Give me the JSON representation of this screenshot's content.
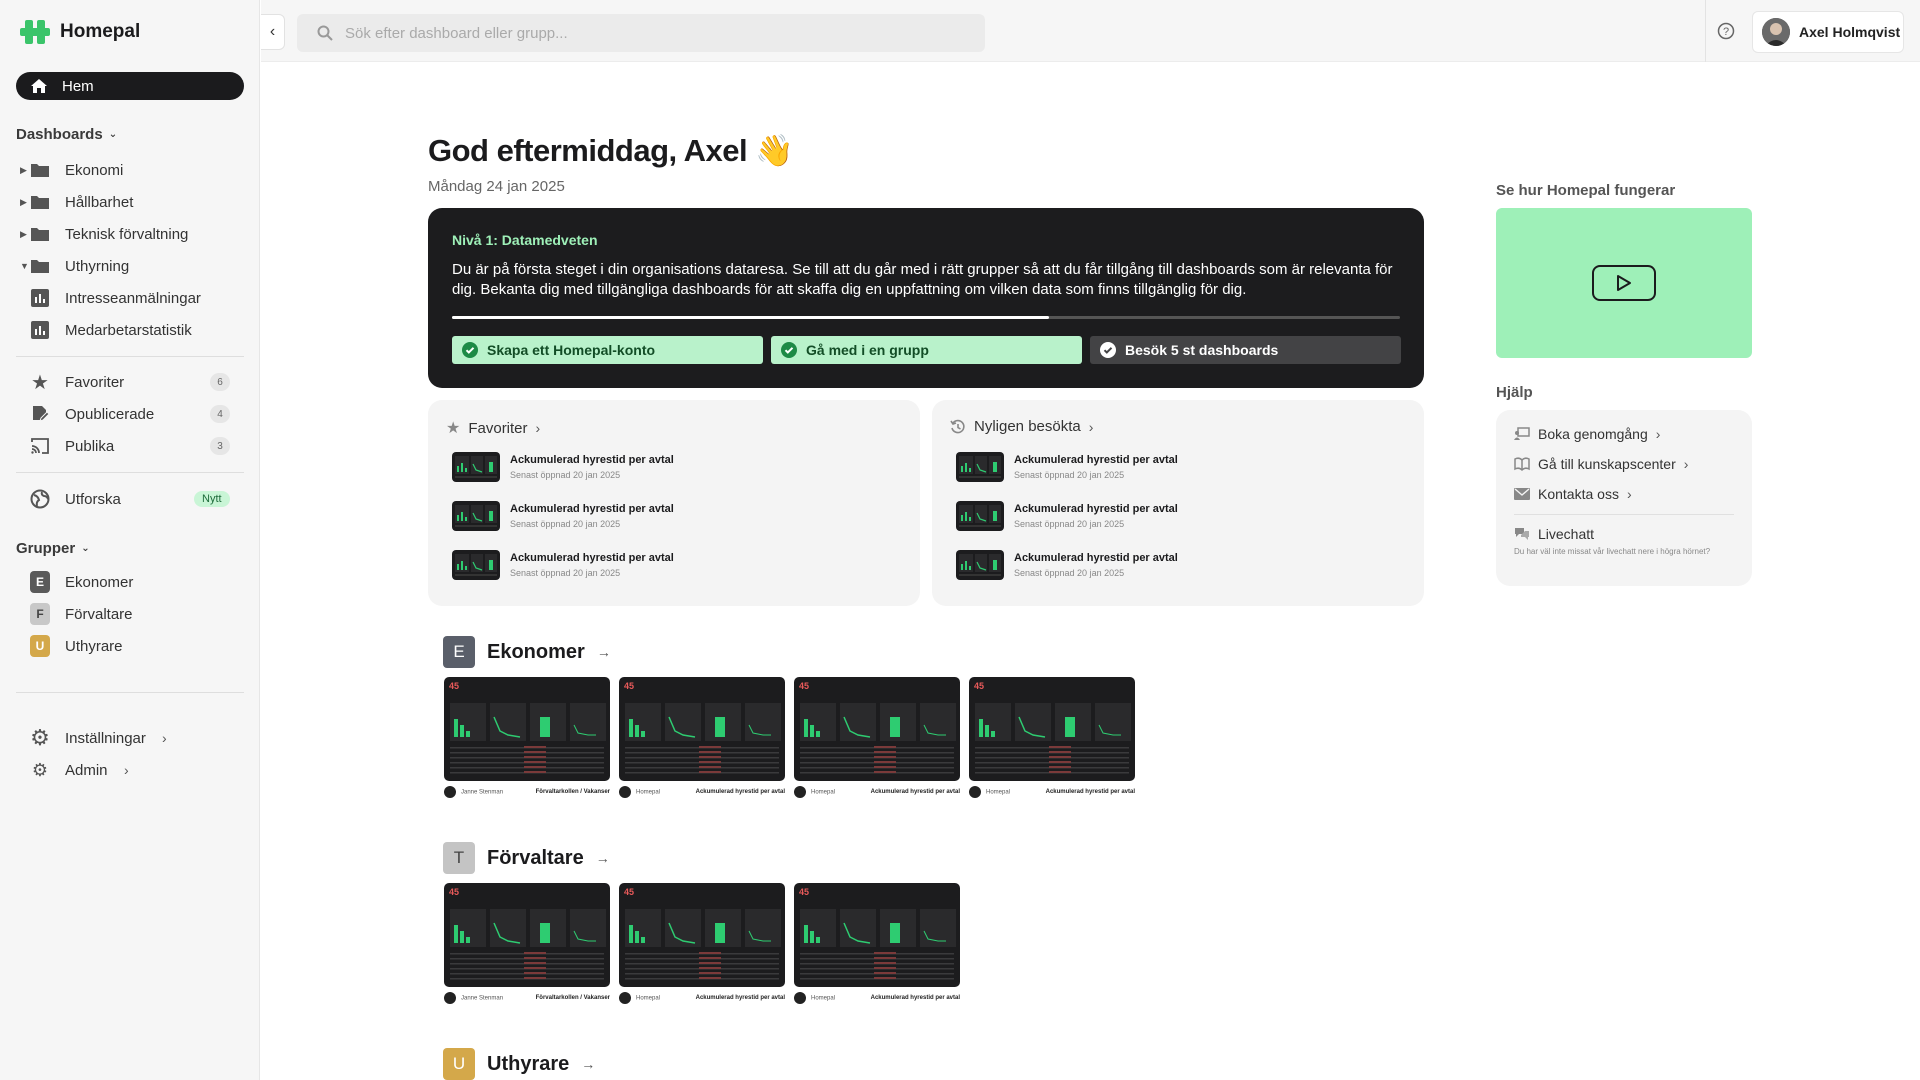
{
  "app": {
    "name": "Homepal"
  },
  "nav": {
    "home": "Hem",
    "dashboards_label": "Dashboards",
    "folders": [
      "Ekonomi",
      "Hållbarhet",
      "Teknisk förvaltning",
      "Uthyrning"
    ],
    "sub_dashboards": [
      "Intresseanmälningar",
      "Medarbetarstatistik"
    ],
    "favoriter": {
      "label": "Favoriter",
      "count": "6"
    },
    "opublicerade": {
      "label": "Opublicerade",
      "count": "4"
    },
    "publika": {
      "label": "Publika",
      "count": "3"
    },
    "utforska": {
      "label": "Utforska",
      "badge": "Nytt"
    },
    "grupper_label": "Grupper",
    "groups": [
      {
        "letter": "E",
        "name": "Ekonomer",
        "color": "#5a5a5a"
      },
      {
        "letter": "F",
        "name": "Förvaltare",
        "color": "#bdbdbd"
      },
      {
        "letter": "U",
        "name": "Uthyrare",
        "color": "#d4a84a"
      }
    ],
    "settings": "Inställningar",
    "admin": "Admin"
  },
  "topbar": {
    "search_placeholder": "Sök efter dashboard eller grupp...",
    "user_name": "Axel Holmqvist"
  },
  "main": {
    "greeting": "God eftermiddag, Axel 👋",
    "date": "Måndag 24 jan 2025",
    "level": {
      "title": "Nivå 1: Datamedveten",
      "description": "Du är på första steget i din organisations dataresa. Se till att du går med i rätt grupper så att du får tillgång till dashboards som är relevanta för dig. Bekanta dig med tillgängliga dashboards för att skaffa dig en uppfattning om vilken data som finns tillgänglig för dig.",
      "progress": 0.63,
      "steps": [
        {
          "label": "Skapa ett Homepal-konto",
          "done": true
        },
        {
          "label": "Gå med i en grupp",
          "done": true
        },
        {
          "label": "Besök 5 st dashboards",
          "done": false
        }
      ]
    },
    "favorites": {
      "title": "Favoriter",
      "items": [
        {
          "title": "Ackumulerad hyrestid per avtal",
          "sub": "Senast öppnad 20 jan 2025"
        },
        {
          "title": "Ackumulerad hyrestid per avtal",
          "sub": "Senast öppnad 20 jan 2025"
        },
        {
          "title": "Ackumulerad hyrestid per avtal",
          "sub": "Senast öppnad 20 jan 2025"
        }
      ]
    },
    "recent": {
      "title": "Nyligen besökta",
      "items": [
        {
          "title": "Ackumulerad hyrestid per avtal",
          "sub": "Senast öppnad 20 jan 2025"
        },
        {
          "title": "Ackumulerad hyrestid per avtal",
          "sub": "Senast öppnad 20 jan 2025"
        },
        {
          "title": "Ackumulerad hyrestid per avtal",
          "sub": "Senast öppnad 20 jan 2025"
        }
      ]
    },
    "groups": [
      {
        "letter": "E",
        "name": "Ekonomer",
        "color": "#5a5f6a",
        "cards": [
          {
            "kpi": "45",
            "owner": "Janne Stenman",
            "title": "Förvaltarkollen / Vakanser"
          },
          {
            "kpi": "45",
            "owner": "Homepal",
            "title": "Ackumulerad hyrestid per avtal"
          },
          {
            "kpi": "45",
            "owner": "Homepal",
            "title": "Ackumulerad hyrestid per avtal"
          },
          {
            "kpi": "45",
            "owner": "Homepal",
            "title": "Ackumulerad hyrestid per avtal"
          }
        ]
      },
      {
        "letter": "T",
        "name": "Förvaltare",
        "color": "#c4c4c4",
        "cards": [
          {
            "kpi": "45",
            "owner": "Janne Stenman",
            "title": "Förvaltarkollen / Vakanser"
          },
          {
            "kpi": "45",
            "owner": "Homepal",
            "title": "Ackumulerad hyrestid per avtal"
          },
          {
            "kpi": "45",
            "owner": "Homepal",
            "title": "Ackumulerad hyrestid per avtal"
          }
        ]
      },
      {
        "letter": "U",
        "name": "Uthyrare",
        "color": "#d4a84a",
        "cards": []
      }
    ]
  },
  "right": {
    "video_label": "Se hur Homepal fungerar",
    "help_label": "Hjälp",
    "links": [
      "Boka genomgång",
      "Gå till kunskapscenter",
      "Kontakta oss"
    ],
    "livechat": {
      "title": "Livechatt",
      "sub": "Du har väl inte missat vår livechatt nere i högra hörnet?"
    }
  },
  "colors": {
    "accent": "#9ef0b8",
    "dark": "#1c1c1e",
    "kpi": "#e85a5a",
    "bar": "#2ecc71"
  }
}
